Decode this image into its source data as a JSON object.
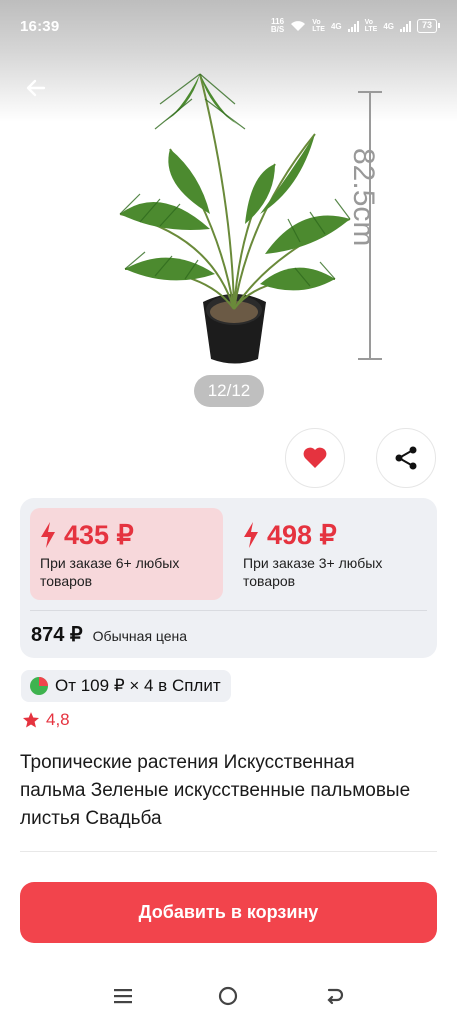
{
  "status_bar": {
    "time": "16:39",
    "net_speed_value": "116",
    "net_speed_unit": "B/S",
    "volte1": "Vo",
    "lte1": "LTE",
    "volte2": "Vo",
    "lte2": "LTE",
    "net_4g_1": "4G",
    "net_4g_2": "4G",
    "battery": "73"
  },
  "gallery": {
    "dimension_label": "82.5cm",
    "counter": "12/12"
  },
  "prices": {
    "option_1": {
      "value": "435 ₽",
      "condition": "При заказе 6+ любых товаров"
    },
    "option_2": {
      "value": "498 ₽",
      "condition": "При заказе 3+ любых товаров"
    },
    "regular_value": "874 ₽",
    "regular_label": "Обычная цена"
  },
  "split": {
    "text": "От 109 ₽ × 4 в Сплит"
  },
  "rating": {
    "value": "4,8"
  },
  "product": {
    "title": "Тропические растения Искусственная пальма Зеленые искусственные пальмовые листья Свадьба"
  },
  "cart_button": {
    "label": "Добавить в корзину"
  },
  "colors": {
    "accent": "#f2444c",
    "price_red": "#e5333f",
    "card_bg": "#eef0f4",
    "active_option_bg": "#f7d8db"
  }
}
